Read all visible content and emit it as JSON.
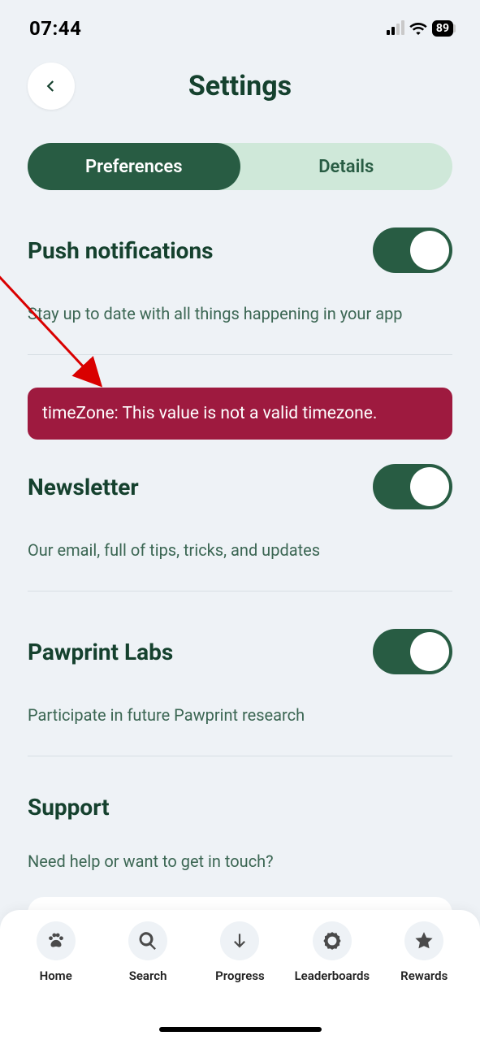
{
  "status": {
    "time": "07:44",
    "battery": "89"
  },
  "header": {
    "title": "Settings"
  },
  "tabs": {
    "preferences": "Preferences",
    "details": "Details"
  },
  "sections": {
    "push": {
      "title": "Push notifications",
      "desc": "Stay up to date with all things happening in your app",
      "on": true
    },
    "newsletter": {
      "title": "Newsletter",
      "desc": "Our email, full of tips, tricks, and updates",
      "on": true
    },
    "labs": {
      "title": "Pawprint Labs",
      "desc": "Participate in future Pawprint research",
      "on": true
    },
    "support": {
      "title": "Support",
      "desc": "Need help or want to get in touch?"
    }
  },
  "error": "timeZone: This value is not a valid timezone.",
  "nav": {
    "home": "Home",
    "search": "Search",
    "progress": "Progress",
    "leaderboards": "Leaderboards",
    "rewards": "Rewards"
  }
}
